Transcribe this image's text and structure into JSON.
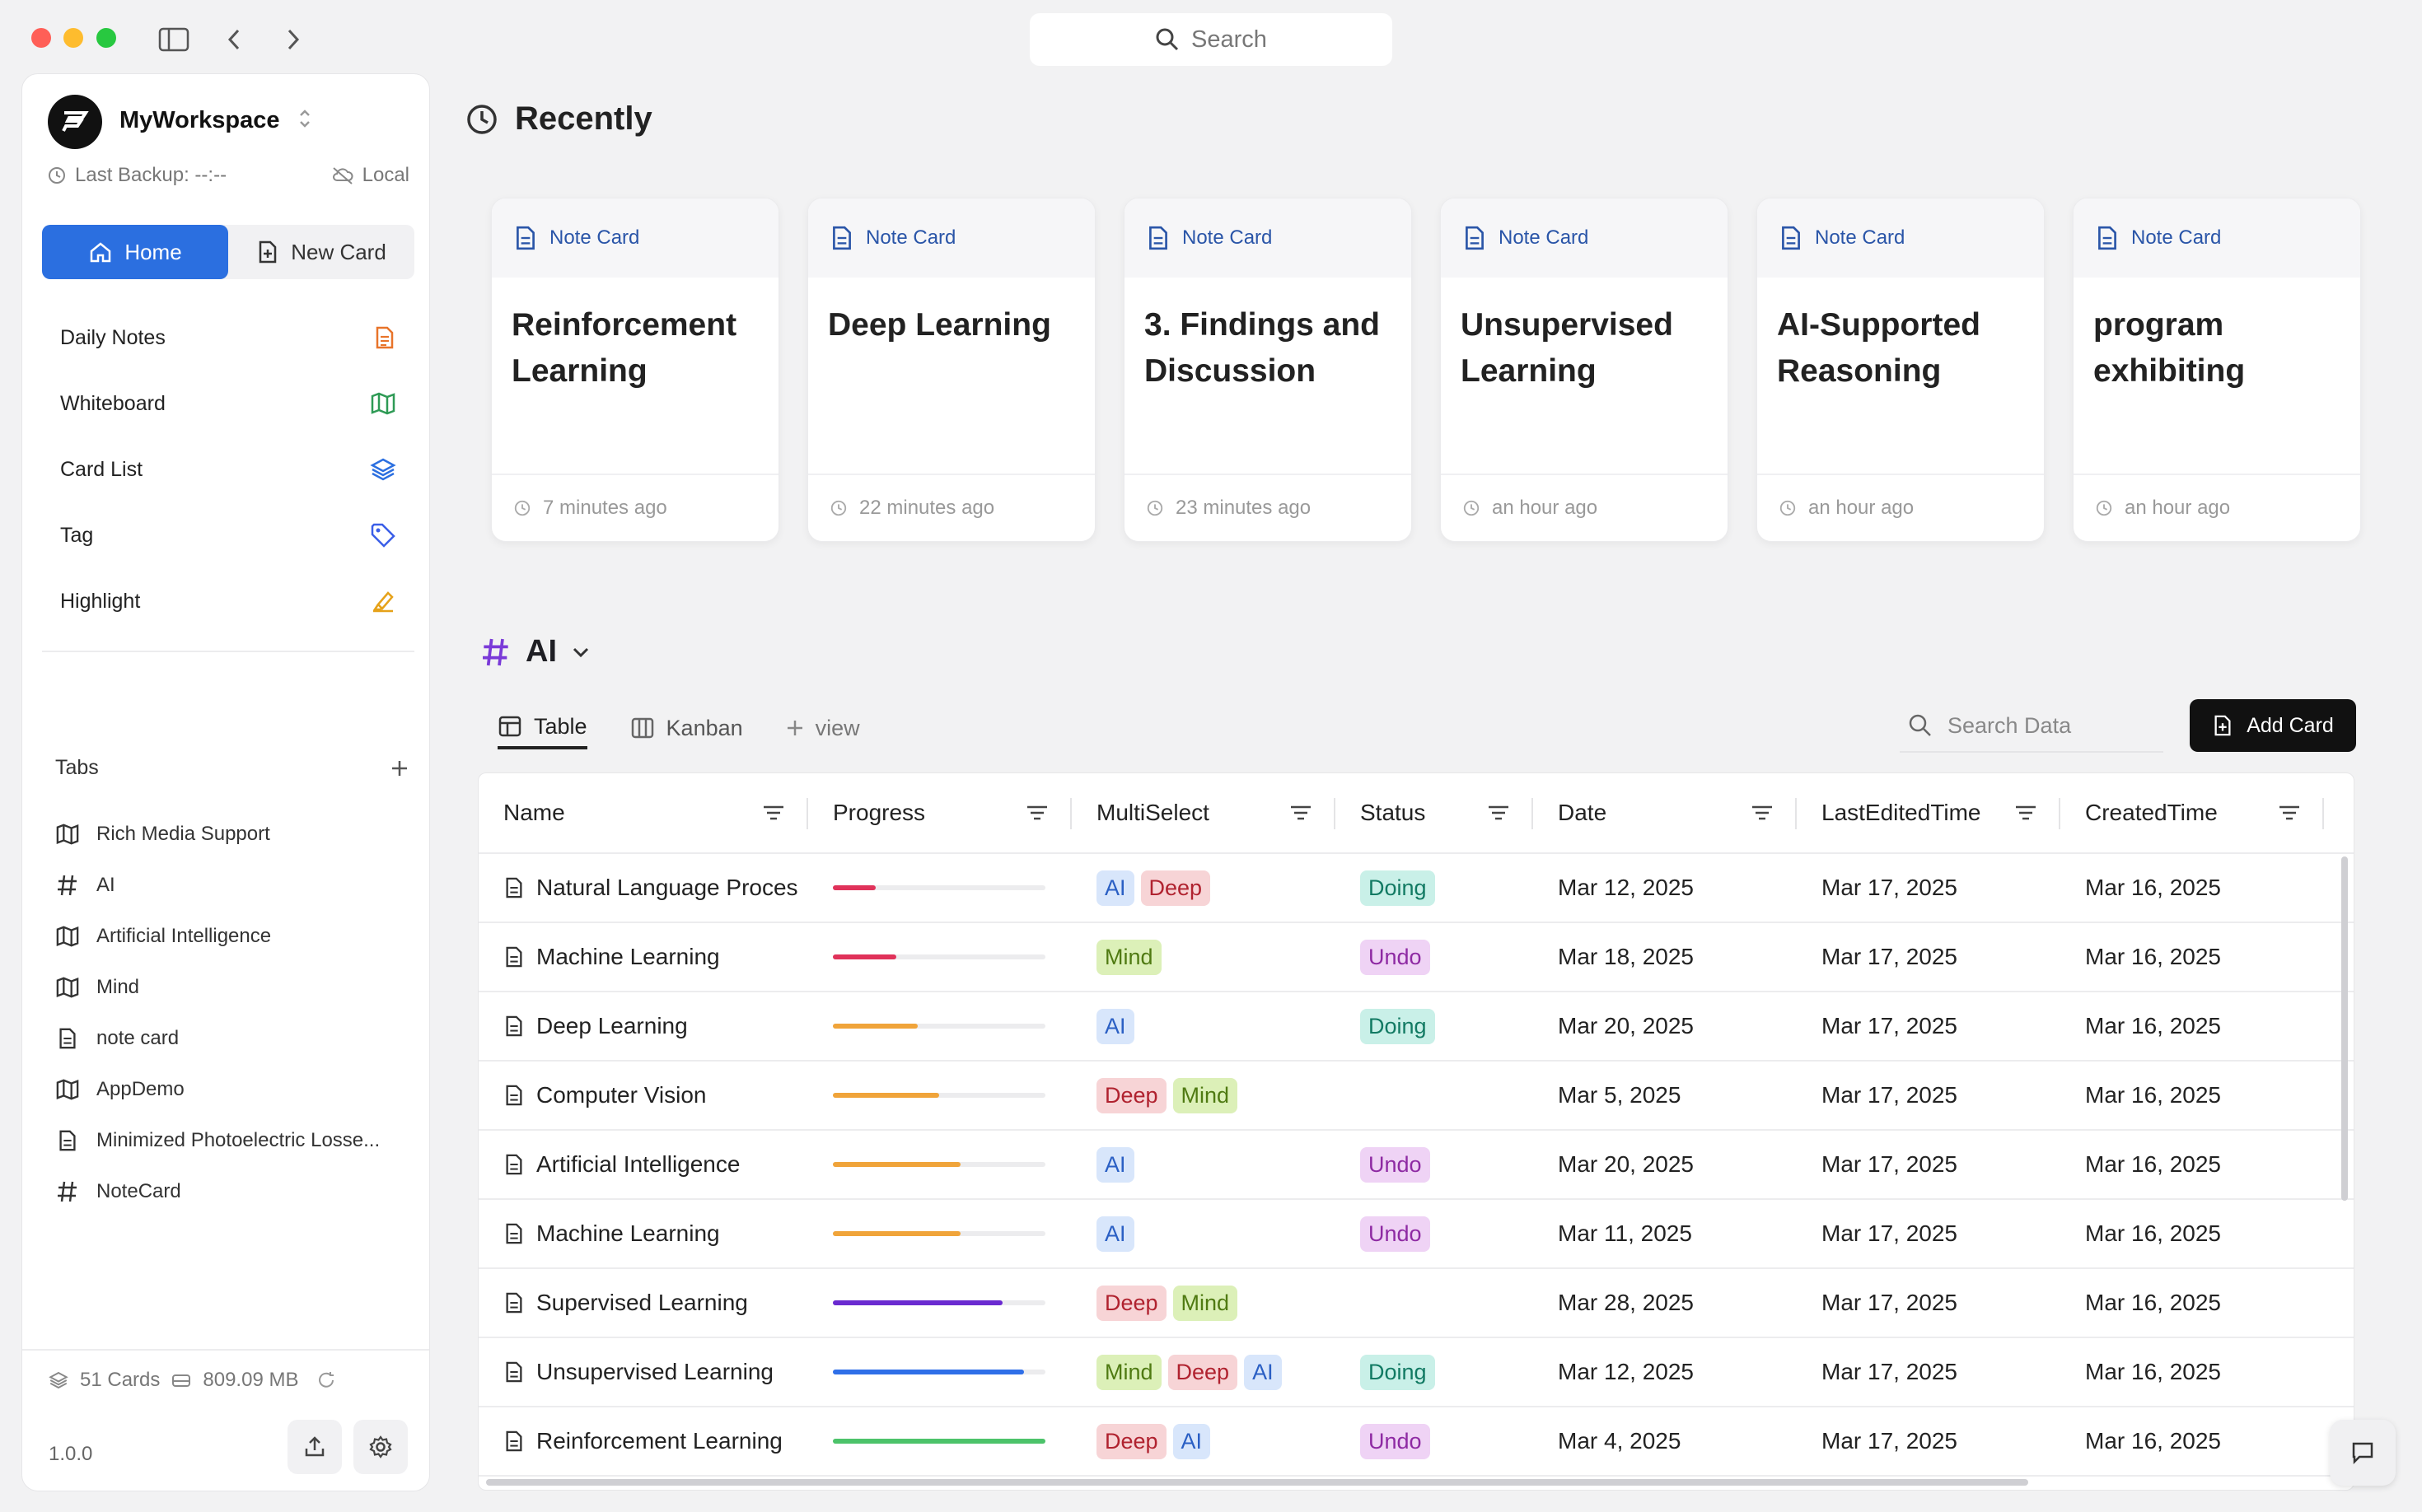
{
  "topbar": {
    "search_placeholder": "Search"
  },
  "workspace": {
    "name": "MyWorkspace",
    "backup_label": "Last Backup: --:--",
    "storage_mode": "Local"
  },
  "segment": {
    "home_label": "Home",
    "new_card_label": "New Card"
  },
  "nav": [
    {
      "label": "Daily Notes",
      "icon": "daily-notes-icon",
      "color": "#e8742a"
    },
    {
      "label": "Whiteboard",
      "icon": "whiteboard-map-icon",
      "color": "#2e9a55"
    },
    {
      "label": "Card List",
      "icon": "layers-icon",
      "color": "#2b6fe0"
    },
    {
      "label": "Tag",
      "icon": "tag-icon",
      "color": "#3a5ee8"
    },
    {
      "label": "Highlight",
      "icon": "highlighter-icon",
      "color": "#e6a21a"
    }
  ],
  "tabs": {
    "title": "Tabs",
    "items": [
      {
        "label": "Rich Media Support",
        "icon": "map-icon"
      },
      {
        "label": "AI",
        "icon": "hash-icon"
      },
      {
        "label": "Artificial Intelligence",
        "icon": "map-icon"
      },
      {
        "label": "Mind",
        "icon": "map-icon"
      },
      {
        "label": "note card",
        "icon": "document-icon"
      },
      {
        "label": "AppDemo",
        "icon": "map-icon"
      },
      {
        "label": "Minimized Photoelectric Losse...",
        "icon": "document-icon"
      },
      {
        "label": "NoteCard",
        "icon": "hash-icon"
      }
    ]
  },
  "footer": {
    "cards": "51 Cards",
    "size": "809.09 MB",
    "version": "1.0.0"
  },
  "recent": {
    "title": "Recently",
    "cards": [
      {
        "type": "Note Card",
        "title": "Reinforcement Learning",
        "time": "7 minutes ago"
      },
      {
        "type": "Note Card",
        "title": "Deep Learning",
        "time": "22 minutes ago"
      },
      {
        "type": "Note Card",
        "title": "3. Findings and Discussion",
        "time": "23 minutes ago"
      },
      {
        "type": "Note Card",
        "title": "Unsupervised Learning",
        "time": "an hour ago"
      },
      {
        "type": "Note Card",
        "title": "AI-Supported Reasoning",
        "time": "an hour ago"
      },
      {
        "type": "Note Card",
        "title": "program exhibiting",
        "time": "an hour ago"
      }
    ]
  },
  "tag_view": {
    "tag": "AI",
    "views": [
      "Table",
      "Kanban",
      "view"
    ],
    "search_placeholder": "Search Data",
    "add_card_label": "Add Card"
  },
  "table": {
    "columns": [
      "Name",
      "Progress",
      "MultiSelect",
      "Status",
      "Date",
      "LastEditedTime",
      "CreatedTime"
    ],
    "rows": [
      {
        "name": "Natural Language Proces",
        "progress": 0.2,
        "progress_color": "#e0325a",
        "tags": [
          "AI",
          "Deep"
        ],
        "status": "Doing",
        "date": "Mar 12, 2025",
        "edited": "Mar 17, 2025",
        "created": "Mar 16, 2025"
      },
      {
        "name": "Machine Learning",
        "progress": 0.3,
        "progress_color": "#e0325a",
        "tags": [
          "Mind"
        ],
        "status": "Undo",
        "date": "Mar 18, 2025",
        "edited": "Mar 17, 2025",
        "created": "Mar 16, 2025"
      },
      {
        "name": "Deep Learning",
        "progress": 0.4,
        "progress_color": "#f0a43a",
        "tags": [
          "AI"
        ],
        "status": "Doing",
        "date": "Mar 20, 2025",
        "edited": "Mar 17, 2025",
        "created": "Mar 16, 2025"
      },
      {
        "name": "Computer Vision",
        "progress": 0.5,
        "progress_color": "#f0a43a",
        "tags": [
          "Deep",
          "Mind"
        ],
        "status": "",
        "date": "Mar 5, 2025",
        "edited": "Mar 17, 2025",
        "created": "Mar 16, 2025"
      },
      {
        "name": "Artificial Intelligence",
        "progress": 0.6,
        "progress_color": "#f0a43a",
        "tags": [
          "AI"
        ],
        "status": "Undo",
        "date": "Mar 20, 2025",
        "edited": "Mar 17, 2025",
        "created": "Mar 16, 2025"
      },
      {
        "name": "Machine Learning",
        "progress": 0.6,
        "progress_color": "#f0a43a",
        "tags": [
          "AI"
        ],
        "status": "Undo",
        "date": "Mar 11, 2025",
        "edited": "Mar 17, 2025",
        "created": "Mar 16, 2025"
      },
      {
        "name": "Supervised Learning",
        "progress": 0.8,
        "progress_color": "#6a2ad0",
        "tags": [
          "Deep",
          "Mind"
        ],
        "status": "",
        "date": "Mar 28, 2025",
        "edited": "Mar 17, 2025",
        "created": "Mar 16, 2025"
      },
      {
        "name": "Unsupervised Learning",
        "progress": 0.9,
        "progress_color": "#2f6fe8",
        "tags": [
          "Mind",
          "Deep",
          "AI"
        ],
        "status": "Doing",
        "date": "Mar 12, 2025",
        "edited": "Mar 17, 2025",
        "created": "Mar 16, 2025"
      },
      {
        "name": "Reinforcement Learning",
        "progress": 1.0,
        "progress_color": "#4cc36a",
        "tags": [
          "Deep",
          "AI"
        ],
        "status": "Undo",
        "date": "Mar 4, 2025",
        "edited": "Mar 17, 2025",
        "created": "Mar 16, 2025"
      }
    ]
  }
}
